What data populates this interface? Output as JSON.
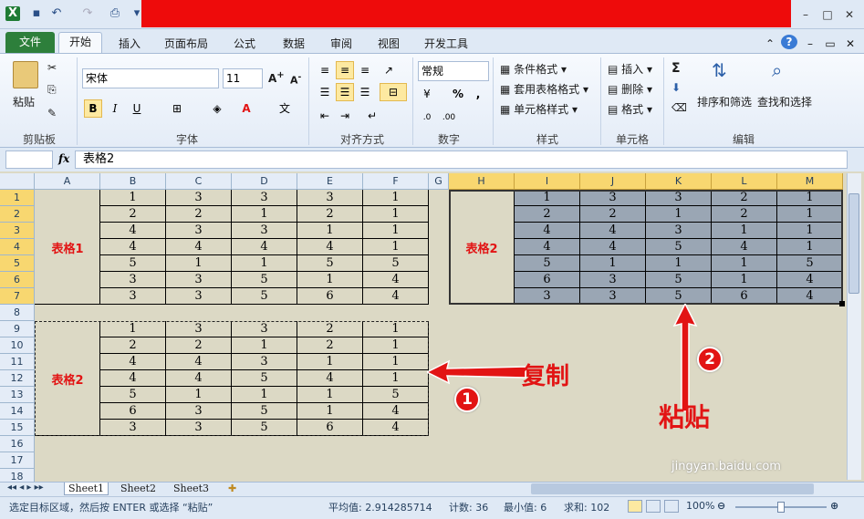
{
  "titlebar": {
    "undo": "↶",
    "redo": "↷",
    "min": "–",
    "max": "□",
    "close": "✕"
  },
  "tabs": {
    "file": "文件",
    "home": "开始",
    "items": [
      "插入",
      "页面布局",
      "公式",
      "数据",
      "审阅",
      "视图",
      "开发工具"
    ]
  },
  "ribbon": {
    "clipboard": {
      "paste": "粘贴",
      "label": "剪贴板"
    },
    "font": {
      "name": "宋体",
      "size": "11",
      "bold": "B",
      "italic": "I",
      "underline": "U",
      "label": "字体"
    },
    "alignment": {
      "label": "对齐方式"
    },
    "number": {
      "format": "常规",
      "percent": "%",
      "comma": ",",
      "label": "数字"
    },
    "styles": {
      "cond": "条件格式",
      "table": "套用表格格式",
      "cell": "单元格样式",
      "label": "样式"
    },
    "cells": {
      "insert": "插入",
      "delete": "删除",
      "format": "格式",
      "label": "单元格"
    },
    "editing": {
      "sort": "排序和筛选",
      "find": "查找和选择",
      "sum": "Σ",
      "label": "编辑"
    }
  },
  "formula_bar": {
    "fx": "fx",
    "value": "表格2"
  },
  "columns": [
    "A",
    "B",
    "C",
    "D",
    "E",
    "F",
    "G",
    "H",
    "I",
    "J",
    "K",
    "L",
    "M"
  ],
  "rows": [
    "1",
    "2",
    "3",
    "4",
    "5",
    "6",
    "7",
    "8",
    "9",
    "10",
    "11",
    "12",
    "13",
    "14",
    "15",
    "16",
    "17",
    "18"
  ],
  "table1": {
    "label": "表格1",
    "data": [
      [
        "1",
        "3",
        "3",
        "3",
        "1"
      ],
      [
        "2",
        "2",
        "1",
        "2",
        "1"
      ],
      [
        "4",
        "3",
        "3",
        "1",
        "1"
      ],
      [
        "4",
        "4",
        "4",
        "4",
        "1"
      ],
      [
        "5",
        "1",
        "1",
        "5",
        "5"
      ],
      [
        "3",
        "3",
        "5",
        "1",
        "4"
      ],
      [
        "3",
        "3",
        "5",
        "6",
        "4"
      ]
    ]
  },
  "table2_src": {
    "label": "表格2",
    "data": [
      [
        "1",
        "3",
        "3",
        "2",
        "1"
      ],
      [
        "2",
        "2",
        "1",
        "2",
        "1"
      ],
      [
        "4",
        "4",
        "3",
        "1",
        "1"
      ],
      [
        "4",
        "4",
        "5",
        "4",
        "1"
      ],
      [
        "5",
        "1",
        "1",
        "1",
        "5"
      ],
      [
        "6",
        "3",
        "5",
        "1",
        "4"
      ],
      [
        "3",
        "3",
        "5",
        "6",
        "4"
      ]
    ]
  },
  "table2_pasted": {
    "label": "表格2",
    "data": [
      [
        "1",
        "3",
        "3",
        "2",
        "1"
      ],
      [
        "2",
        "2",
        "1",
        "2",
        "1"
      ],
      [
        "4",
        "4",
        "3",
        "1",
        "1"
      ],
      [
        "4",
        "4",
        "5",
        "4",
        "1"
      ],
      [
        "5",
        "1",
        "1",
        "1",
        "5"
      ],
      [
        "6",
        "3",
        "5",
        "1",
        "4"
      ],
      [
        "3",
        "3",
        "5",
        "6",
        "4"
      ]
    ]
  },
  "annotations": {
    "copy": "复制",
    "paste": "粘贴",
    "badge1": "1",
    "badge2": "2"
  },
  "watermark": {
    "site": "jingyan.baidu.com"
  },
  "sheets": [
    "Sheet1",
    "Sheet2",
    "Sheet3"
  ],
  "status": {
    "message": "选定目标区域，然后按 ENTER 或选择 “粘贴”",
    "average": "平均值: 2.914285714",
    "count": "计数: 36",
    "min": "最小值: 6",
    "sum": "求和: 102",
    "zoom": "100%"
  },
  "colors": {
    "accent": "#e21414",
    "selection": "#9aa6b4",
    "sheet": "#dcd9c5"
  }
}
